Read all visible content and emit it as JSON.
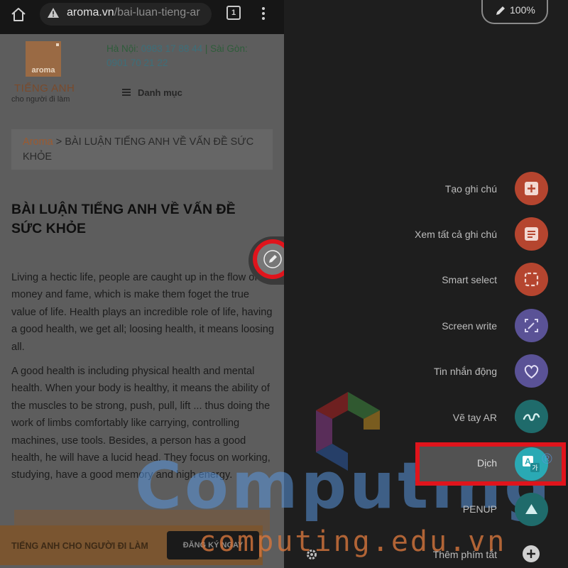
{
  "browser": {
    "url_domain": "aroma.vn",
    "url_path": "/bai-luan-tieng-ar",
    "tab_count": "1",
    "logo": {
      "word": "aroma",
      "line1": "TIẾNG ANH",
      "line2": "cho người đi làm"
    },
    "contact": {
      "hanoi_label": "Hà Nội:",
      "hanoi_phone": "0983 17 88 44",
      "separator": "|",
      "saigon_label": "Sài Gòn:",
      "saigon_phone": "0901 70 21 22"
    },
    "menu_label": "Danh mục",
    "breadcrumb": {
      "link": "Aroma",
      "separator": ">",
      "current": "BÀI LUẬN TIẾNG ANH VỀ VẤN ĐỀ SỨC KHỎE"
    },
    "article_title": "BÀI LUẬN TIẾNG ANH VỀ VẤN ĐỀ SỨC KHỎE",
    "paragraphs": [
      "Living a hectic life, people are caught up in the flow of money and fame, which is make them foget the true value of life. Health plays an incredible role of life, having a good health, we get all; loosing health, it means loosing all.",
      "A good health is including physical health and mental health. When your body is healthy, it means the ability of the muscles to be strong, push, pull, lift ... thus doing the work of limbs comfortably like carrying, controlling machines, use tools. Besides, a person has a good health, he will have a lucid head. They focus on working, studying, have a good memory and high energy."
    ],
    "banner": {
      "text": "TIẾNG ANH CHO NGƯỜI ĐI LÀM",
      "button": "ĐĂNG KÝ NGAY"
    }
  },
  "air_command": {
    "pen_battery": "100%",
    "items": [
      {
        "label": "Tạo ghi chú",
        "icon": "create-note-icon",
        "color": "#b5452f"
      },
      {
        "label": "Xem tất cả ghi chú",
        "icon": "view-notes-icon",
        "color": "#b5452f"
      },
      {
        "label": "Smart select",
        "icon": "smart-select-icon",
        "color": "#b5452f"
      },
      {
        "label": "Screen write",
        "icon": "screen-write-icon",
        "color": "#5a5296"
      },
      {
        "label": "Tin nhắn động",
        "icon": "live-message-icon",
        "color": "#5a5296"
      },
      {
        "label": "Vẽ tay AR",
        "icon": "ar-doodle-icon",
        "color": "#1f6b6b"
      },
      {
        "label": "Dịch",
        "icon": "translate-icon",
        "color": "#2aa9b4"
      },
      {
        "label": "PENUP",
        "icon": "penup-icon",
        "color": "#1f6b6b"
      }
    ],
    "add_shortcut": "Thêm phím tắt",
    "highlight_color": "#e0141c"
  },
  "watermark": {
    "word": "Computing",
    "site": "computing.edu.vn",
    "reg": "®"
  }
}
